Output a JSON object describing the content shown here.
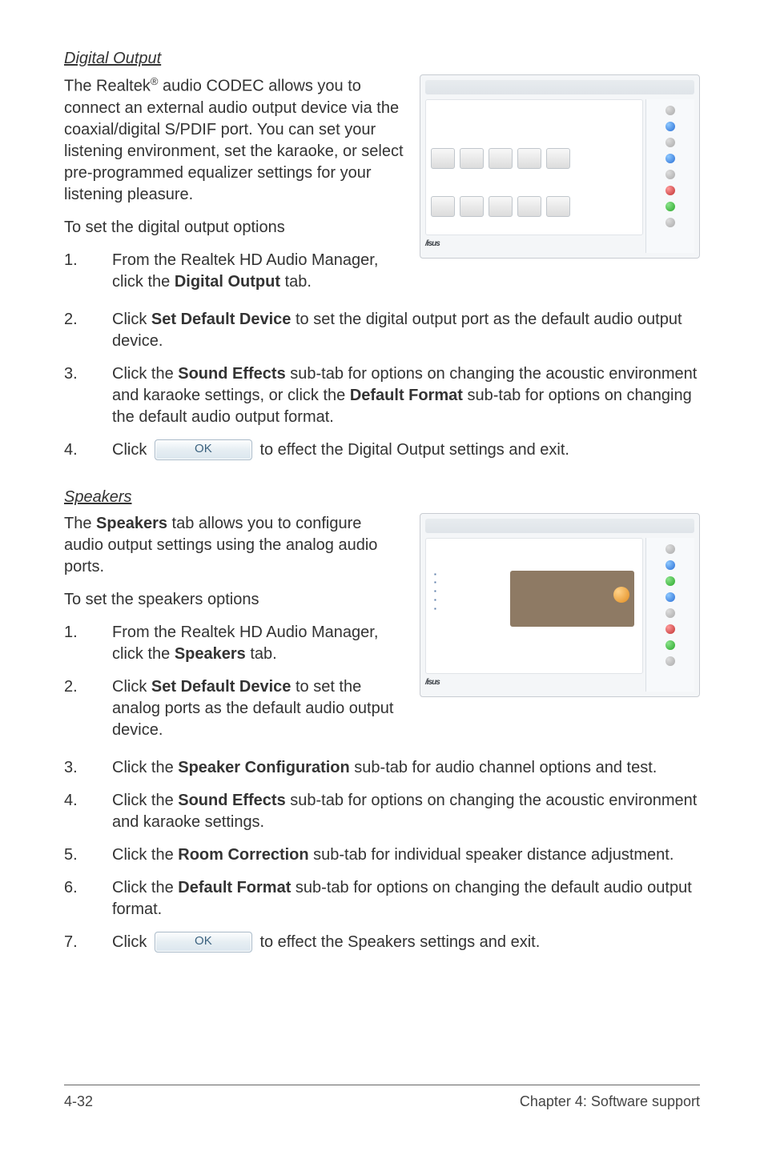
{
  "sections": {
    "digital_output": {
      "heading": "Digital Output",
      "intro_pre": "The Realtek",
      "intro_sup": "®",
      "intro_post": " audio CODEC allows you to connect an external audio output device via the coaxial/digital S/PDIF port. You can set your listening environment, set the karaoke, or select pre-programmed equalizer settings for your listening pleasure.",
      "lead": "To set the digital output options",
      "steps": [
        {
          "num": "1.",
          "pre": "From the Realtek HD Audio Manager, click the ",
          "bold": "Digital Output",
          "post": " tab."
        },
        {
          "num": "2.",
          "pre": "Click ",
          "bold": "Set Default Device",
          "post": " to set the digital output port as the default audio output device."
        },
        {
          "num": "3.",
          "pre": "Click the ",
          "bold": "Sound Effects",
          "mid": " sub-tab for options on changing the acoustic environment and karaoke settings, or click the ",
          "bold2": "Default Format",
          "post": " sub-tab for options on changing the default audio output format."
        },
        {
          "num": "4.",
          "pre": "Click ",
          "btn": "OK",
          "post": " to effect the Digital Output settings and exit."
        }
      ]
    },
    "speakers": {
      "heading": "Speakers",
      "intro_pre": "The ",
      "intro_bold": "Speakers",
      "intro_post": " tab allows you to configure audio output settings using the analog audio ports.",
      "lead": "To set the speakers options",
      "steps": [
        {
          "num": "1.",
          "pre": "From the Realtek HD Audio Manager, click the ",
          "bold": "Speakers",
          "post": " tab."
        },
        {
          "num": "2.",
          "pre": "Click ",
          "bold": "Set Default Device",
          "post": " to set the analog ports as the default audio output device."
        },
        {
          "num": "3.",
          "pre": "Click the ",
          "bold": "Speaker Configuration",
          "post": " sub-tab for audio channel options and test."
        },
        {
          "num": "4.",
          "pre": "Click the ",
          "bold": "Sound Effects",
          "post": " sub-tab for options on changing the acoustic environment and karaoke settings."
        },
        {
          "num": "5.",
          "pre": "Click the ",
          "bold": "Room Correction",
          "post": " sub-tab for individual speaker distance adjustment."
        },
        {
          "num": "6.",
          "pre": "Click the ",
          "bold": "Default Format",
          "post": " sub-tab for options on changing the default audio output format."
        },
        {
          "num": "7.",
          "pre": "Click ",
          "btn": "OK",
          "post": " to effect the Speakers settings and exit."
        }
      ]
    }
  },
  "screenshot": {
    "brand": "/isus"
  },
  "ok_label": "OK",
  "footer": {
    "left": "4-32",
    "right": "Chapter 4: Software support"
  }
}
